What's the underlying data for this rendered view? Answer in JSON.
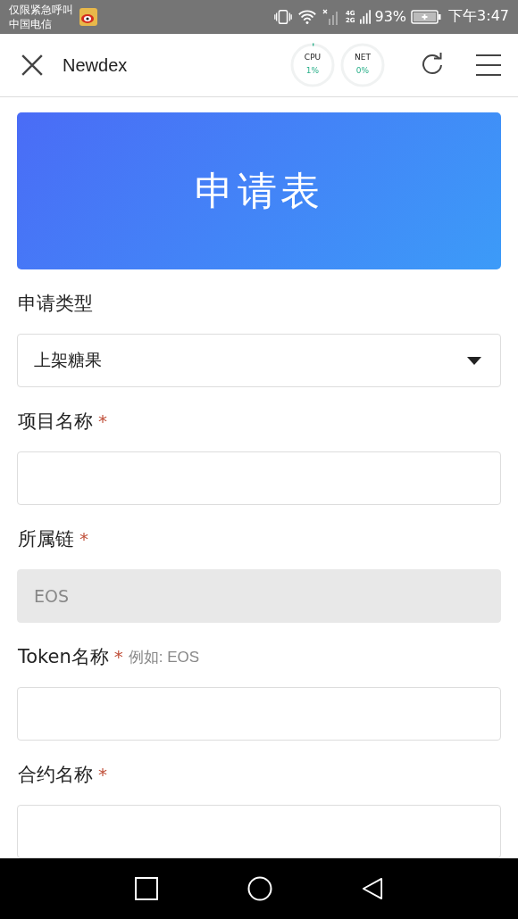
{
  "status_bar": {
    "carrier_lines": [
      "仅限紧急呼叫",
      "中国电信"
    ],
    "network": "4G\n2G",
    "battery": "93%",
    "time": "下午3:47"
  },
  "header": {
    "title": "Newdex",
    "meters": [
      {
        "label": "CPU",
        "reading": "1%",
        "level": 0.01
      },
      {
        "label": "NET",
        "reading": "0%",
        "level": 0
      }
    ]
  },
  "banner": {
    "title": "申请表"
  },
  "fields": [
    {
      "kind": "select",
      "label": "申请类型",
      "value": "上架糖果"
    },
    {
      "kind": "input",
      "label": "项目名称",
      "required_mark": "*"
    },
    {
      "kind": "input",
      "label": "所属链",
      "required_mark": "*",
      "value": "EOS",
      "disabled": true
    },
    {
      "kind": "input",
      "label": "Token名称",
      "required_mark": "*",
      "hint": "例如: EOS"
    },
    {
      "kind": "input",
      "label": "合约名称",
      "required_mark": "*"
    }
  ]
}
